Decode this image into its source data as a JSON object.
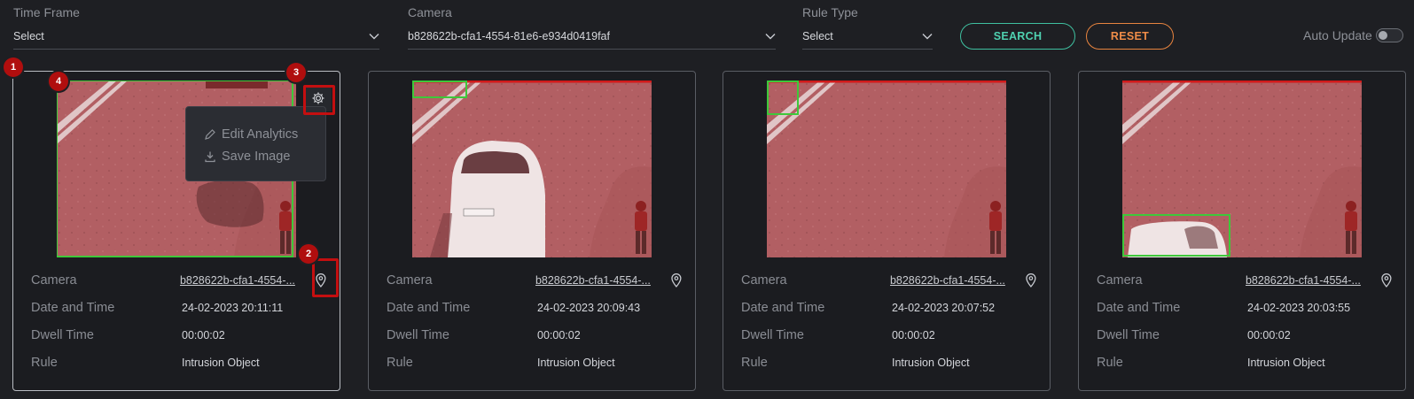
{
  "filters": {
    "time_frame": {
      "label": "Time Frame",
      "value": "Select"
    },
    "camera": {
      "label": "Camera",
      "value": "b828622b-cfa1-4554-81e6-e934d0419faf"
    },
    "rule_type": {
      "label": "Rule Type",
      "value": "Select"
    },
    "search_label": "SEARCH",
    "reset_label": "RESET",
    "auto_update_label": "Auto Update",
    "auto_update_on": false
  },
  "field_labels": {
    "camera": "Camera",
    "datetime": "Date and Time",
    "dwell": "Dwell Time",
    "rule": "Rule"
  },
  "cards": [
    {
      "camera": "b828622b-cfa1-4554-...",
      "datetime": "24-02-2023 20:11:11",
      "dwell": "00:00:02",
      "rule": "Intrusion Object"
    },
    {
      "camera": "b828622b-cfa1-4554-...",
      "datetime": "24-02-2023 20:09:43",
      "dwell": "00:00:02",
      "rule": "Intrusion Object"
    },
    {
      "camera": "b828622b-cfa1-4554-...",
      "datetime": "24-02-2023 20:07:52",
      "dwell": "00:00:02",
      "rule": "Intrusion Object"
    },
    {
      "camera": "b828622b-cfa1-4554-...",
      "datetime": "24-02-2023 20:03:55",
      "dwell": "00:00:02",
      "rule": "Intrusion Object"
    }
  ],
  "context_menu": {
    "edit": "Edit Analytics",
    "save": "Save Image"
  },
  "markers": [
    "1",
    "2",
    "3",
    "4"
  ],
  "colors": {
    "accent_search": "#4fd1b0",
    "accent_reset": "#f08d48",
    "highlight": "#c40f10",
    "detection_box": "#3ec83a"
  }
}
